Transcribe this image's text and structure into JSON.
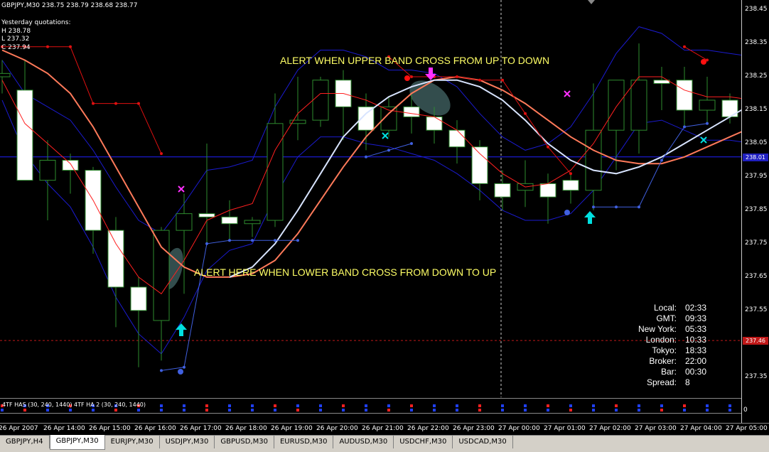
{
  "symbol_line": "GBPJPY,M30  238.75 238.79 238.68 238.77",
  "yesterday": {
    "title": "Yesterday quotations:",
    "high": "H 238.78",
    "low": "L 237.32",
    "close": "C 237.94"
  },
  "alerts": {
    "upper": "ALERT WHEN UPPER BAND CROSS FROM UP TO DOWN",
    "lower": "ALERT HERE WHEN LOWER BAND CROSS FROM DOWN TO UP"
  },
  "time_panel": [
    {
      "label": "Local:",
      "value": "02:33"
    },
    {
      "label": "GMT:",
      "value": "09:33"
    },
    {
      "label": "New York:",
      "value": "05:33"
    },
    {
      "label": "London:",
      "value": "10:33"
    },
    {
      "label": "Tokyo:",
      "value": "18:33"
    },
    {
      "label": "Broker:",
      "value": "22:00"
    },
    {
      "label": "Bar:",
      "value": "00:30"
    },
    {
      "label": "Spread:",
      "value": "8"
    }
  ],
  "price_axis": {
    "ticks": [
      "238.45",
      "238.35",
      "238.25",
      "238.15",
      "238.05",
      "237.95",
      "237.85",
      "237.75",
      "237.65",
      "237.55",
      "237.45",
      "237.35"
    ],
    "current_price": "238.01",
    "red_level": "237.46",
    "range": [
      237.29,
      238.48
    ]
  },
  "indicator": {
    "label": "4TF HAS (30, 240, 1440)  4TF HA 2 (30, 240, 1440)",
    "scale": "0"
  },
  "time_axis": [
    "26 Apr 2007",
    "26 Apr 14:00",
    "26 Apr 15:00",
    "26 Apr 16:00",
    "26 Apr 17:00",
    "26 Apr 18:00",
    "26 Apr 19:00",
    "26 Apr 20:00",
    "26 Apr 21:00",
    "26 Apr 22:00",
    "26 Apr 23:00",
    "27 Apr 00:00",
    "27 Apr 01:00",
    "27 Apr 02:00",
    "27 Apr 03:00",
    "27 Apr 04:00",
    "27 Apr 05:00"
  ],
  "tabs": [
    {
      "label": "GBPJPY,H4",
      "active": false
    },
    {
      "label": "GBPJPY,M30",
      "active": true
    },
    {
      "label": "EURJPY,M30",
      "active": false
    },
    {
      "label": "USDJPY,M30",
      "active": false
    },
    {
      "label": "GBPUSD,M30",
      "active": false
    },
    {
      "label": "EURUSD,M30",
      "active": false
    },
    {
      "label": "AUDUSD,M30",
      "active": false
    },
    {
      "label": "USDCHF,M30",
      "active": false
    },
    {
      "label": "USDCAD,M30",
      "active": false
    }
  ],
  "colors": {
    "bull": "#ffffff",
    "wick": "#2e8b2e",
    "band": "#1b1bd0",
    "mid": "#ff2020",
    "stepline": "#e01010",
    "slow_ma": "#ff7a5a",
    "fast_ma": "#d8e4ff",
    "blue_step": "#4060e0",
    "up_arrow": "#00e0e0",
    "down_arrow": "#ff30ff",
    "cur_line": "#2020ff",
    "red_level": "#c01818"
  },
  "candles": [
    {
      "o": 238.25,
      "h": 238.3,
      "l": 238.2,
      "c": 238.26
    },
    {
      "o": 238.21,
      "h": 238.3,
      "l": 237.95,
      "c": 237.94
    },
    {
      "o": 237.94,
      "h": 238.06,
      "l": 237.82,
      "c": 238.0
    },
    {
      "o": 238.0,
      "h": 238.02,
      "l": 237.9,
      "c": 237.97
    },
    {
      "o": 237.97,
      "h": 237.98,
      "l": 237.72,
      "c": 237.79
    },
    {
      "o": 237.79,
      "h": 237.83,
      "l": 237.5,
      "c": 237.62
    },
    {
      "o": 237.62,
      "h": 237.65,
      "l": 237.38,
      "c": 237.55
    },
    {
      "o": 237.52,
      "h": 237.8,
      "l": 237.4,
      "c": 237.79
    },
    {
      "o": 237.79,
      "h": 237.9,
      "l": 237.6,
      "c": 237.84
    },
    {
      "o": 237.84,
      "h": 238.05,
      "l": 237.75,
      "c": 237.83
    },
    {
      "o": 237.83,
      "h": 237.88,
      "l": 237.76,
      "c": 237.81
    },
    {
      "o": 237.81,
      "h": 237.83,
      "l": 237.77,
      "c": 237.82
    },
    {
      "o": 237.82,
      "h": 238.2,
      "l": 237.8,
      "c": 238.11
    },
    {
      "o": 238.11,
      "h": 238.25,
      "l": 238.06,
      "c": 238.12
    },
    {
      "o": 238.12,
      "h": 238.25,
      "l": 238.1,
      "c": 238.24
    },
    {
      "o": 238.24,
      "h": 238.27,
      "l": 238.06,
      "c": 238.16
    },
    {
      "o": 238.16,
      "h": 238.2,
      "l": 238.03,
      "c": 238.09
    },
    {
      "o": 238.09,
      "h": 238.19,
      "l": 238.07,
      "c": 238.16
    },
    {
      "o": 238.16,
      "h": 238.2,
      "l": 238.08,
      "c": 238.13
    },
    {
      "o": 238.13,
      "h": 238.16,
      "l": 238.05,
      "c": 238.09
    },
    {
      "o": 238.09,
      "h": 238.12,
      "l": 237.99,
      "c": 238.04
    },
    {
      "o": 238.04,
      "h": 238.06,
      "l": 237.88,
      "c": 237.93
    },
    {
      "o": 237.93,
      "h": 237.97,
      "l": 237.85,
      "c": 237.89
    },
    {
      "o": 237.91,
      "h": 238.0,
      "l": 237.86,
      "c": 237.93
    },
    {
      "o": 237.93,
      "h": 237.96,
      "l": 237.81,
      "c": 237.89
    },
    {
      "o": 237.94,
      "h": 237.96,
      "l": 237.87,
      "c": 237.91
    },
    {
      "o": 237.91,
      "h": 238.23,
      "l": 237.85,
      "c": 238.09
    },
    {
      "o": 238.09,
      "h": 238.21,
      "l": 237.97,
      "c": 238.24
    },
    {
      "o": 238.09,
      "h": 238.35,
      "l": 238.02,
      "c": 238.24
    },
    {
      "o": 238.24,
      "h": 238.28,
      "l": 238.15,
      "c": 238.23
    },
    {
      "o": 238.24,
      "h": 238.28,
      "l": 238.1,
      "c": 238.15
    },
    {
      "o": 238.15,
      "h": 238.25,
      "l": 238.11,
      "c": 238.18
    },
    {
      "o": 238.18,
      "h": 238.2,
      "l": 238.11,
      "c": 238.13
    },
    {
      "o": 238.13,
      "h": 238.26,
      "l": 238.06,
      "c": 238.23
    }
  ],
  "upper_band": [
    238.3,
    238.2,
    238.16,
    238.12,
    238.03,
    237.92,
    237.82,
    237.78,
    237.87,
    237.97,
    237.98,
    238.0,
    238.16,
    238.27,
    238.33,
    238.33,
    238.31,
    238.27,
    238.27,
    238.26,
    238.22,
    238.14,
    238.07,
    238.03,
    238.05,
    238.1,
    238.2,
    238.32,
    238.4,
    238.38,
    238.33,
    238.33,
    238.32,
    238.31
  ],
  "lower_band": [
    238.18,
    238.02,
    237.93,
    237.86,
    237.74,
    237.59,
    237.48,
    237.42,
    237.53,
    237.67,
    237.73,
    237.75,
    237.89,
    238.01,
    238.07,
    238.07,
    238.05,
    238.04,
    238.02,
    238.0,
    237.96,
    237.91,
    237.85,
    237.82,
    237.82,
    237.84,
    237.91,
    238.01,
    238.11,
    238.12,
    238.09,
    238.06,
    238.06,
    238.05
  ],
  "mid_line": [
    238.24,
    238.11,
    238.05,
    237.99,
    237.88,
    237.75,
    237.65,
    237.6,
    237.7,
    237.82,
    237.85,
    237.87,
    238.03,
    238.14,
    238.2,
    238.2,
    238.18,
    238.15,
    238.14,
    238.13,
    238.09,
    238.02,
    237.96,
    237.92,
    237.93,
    237.97,
    238.05,
    238.16,
    238.25,
    238.25,
    238.21,
    238.19,
    238.19,
    238.18
  ],
  "slow_ma": [
    238.33,
    238.3,
    238.26,
    238.2,
    238.1,
    237.98,
    237.86,
    237.74,
    237.68,
    237.65,
    237.65,
    237.66,
    237.7,
    237.78,
    237.88,
    237.98,
    238.07,
    238.14,
    238.2,
    238.24,
    238.25,
    238.24,
    238.21,
    238.17,
    238.12,
    238.07,
    238.03,
    238.0,
    237.99,
    237.99,
    238.01,
    238.04,
    238.07,
    238.1
  ],
  "fast_ma": [
    null,
    null,
    null,
    null,
    null,
    null,
    null,
    null,
    null,
    null,
    237.65,
    237.68,
    237.75,
    237.85,
    237.96,
    238.07,
    238.14,
    238.19,
    238.22,
    238.24,
    238.24,
    238.22,
    238.18,
    238.12,
    238.05,
    238.0,
    237.97,
    237.96,
    237.98,
    238.01,
    238.05,
    238.09,
    238.13,
    238.17
  ],
  "step_red": [
    238.34,
    238.34,
    238.34,
    238.34,
    238.17,
    238.17,
    238.17,
    238.02,
    null,
    null,
    null,
    null,
    null,
    null,
    null,
    null,
    null,
    238.31,
    238.25,
    238.25,
    238.25,
    238.24,
    238.24,
    238.14,
    238.04,
    237.96,
    null,
    null,
    null,
    null,
    238.34,
    238.3,
    null,
    null
  ],
  "step_blue": [
    null,
    null,
    null,
    null,
    null,
    null,
    null,
    237.37,
    237.38,
    237.75,
    237.76,
    237.76,
    237.76,
    237.76,
    null,
    null,
    238.01,
    238.03,
    238.05,
    null,
    null,
    null,
    null,
    null,
    null,
    null,
    237.86,
    237.86,
    237.86,
    238.0,
    238.1,
    238.11,
    null,
    null
  ]
}
